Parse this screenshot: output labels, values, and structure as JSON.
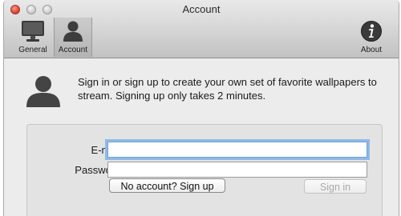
{
  "window": {
    "title": "Account"
  },
  "toolbar": {
    "items": [
      {
        "label": "General",
        "icon": "monitor-icon"
      },
      {
        "label": "Account",
        "icon": "person-icon",
        "selected": true
      },
      {
        "label": "About",
        "icon": "info-icon"
      }
    ]
  },
  "account": {
    "intro": "Sign in or sign up to create your own set of favorite wallpapers to stream. Signing up only takes 2 minutes.",
    "email_label": "E-mail:",
    "email_value": "",
    "password_label": "Password:",
    "password_value": "",
    "signup_button": "No account? Sign up",
    "signin_button": "Sign in",
    "signin_enabled": false
  },
  "colors": {
    "focus_ring": "#8fb9e6",
    "close_button": "#e14a3b"
  }
}
